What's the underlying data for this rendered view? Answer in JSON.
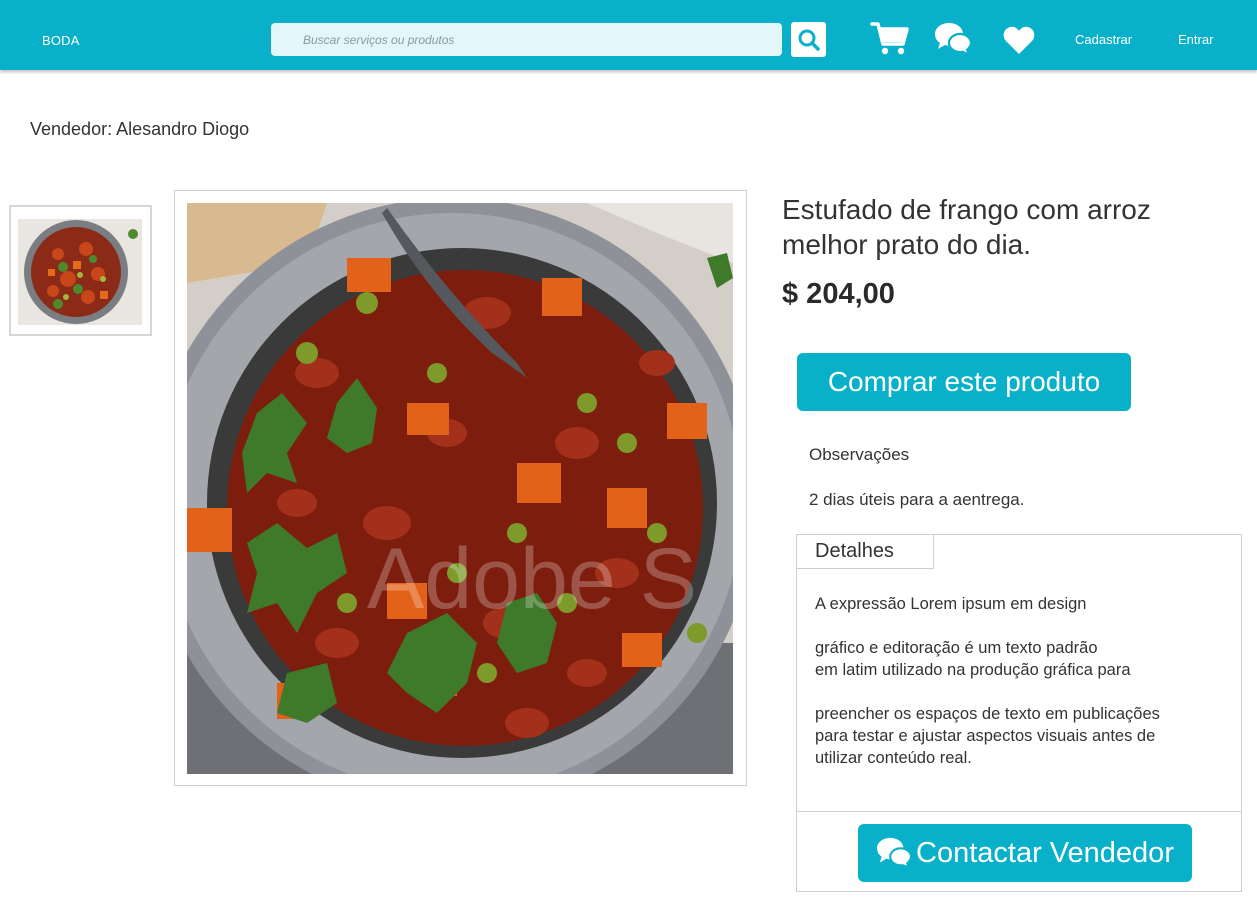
{
  "header": {
    "brand": "BODA",
    "search_placeholder": "Buscar serviços ou produtos",
    "icons": [
      "search-icon",
      "cart-icon",
      "chat-icon",
      "heart-icon"
    ],
    "signup": "Cadastrar",
    "login": "Entrar"
  },
  "vendor": "Vendedor: Alesandro Diogo",
  "product": {
    "title": "Estufado  de  frango com arroz melhor prato do dia.",
    "price": "$ 204,00",
    "buy_label": "Comprar este produto",
    "image_icon": "stew-photo",
    "watermark": "Adobe S"
  },
  "observations": {
    "label": "Observações",
    "text": "2 dias úteis para a aentrega."
  },
  "details": {
    "tab_label": "Detalhes",
    "paragraphs": [
      "A expressão Lorem ipsum em design",
      "gráfico e editoração é um texto padrão\nem latim utilizado na produção gráfica para",
      "preencher os espaços de texto em publicações\npara testar e ajustar aspectos visuais antes de\n utilizar conteúdo real."
    ],
    "contact_label": "Contactar Vendedor"
  },
  "colors": {
    "accent": "#08b1c9",
    "search_bg": "#e3f6fa"
  }
}
